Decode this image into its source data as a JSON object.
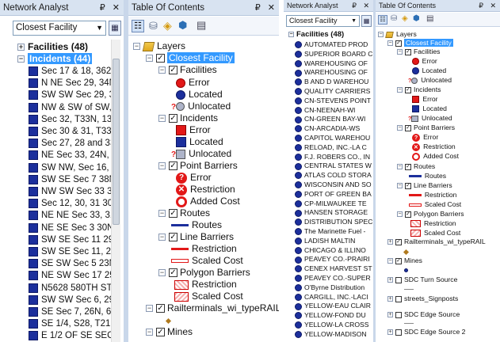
{
  "left_image": {
    "network_analyst": {
      "title": "Network Analyst",
      "title_buttons": "₽ ✕",
      "combo_value": "Closest Facility",
      "facilities_label": "Facilities (48)",
      "incidents_label": "Incidents (44)",
      "incidents": [
        "Sec 17 & 18, 362 25",
        "N NE Sec 29, 34N, 1(",
        "SW SW Sec 29, 34N,",
        "NW & SW of SW, Se",
        "Sec 32, T33N, 13W, 7",
        "Sec 30 & 31, T33N, 1",
        "Sec 27, 28 and 33, T",
        "NE Sec 33, 24N, 11W",
        "SW NW, Sec 16, 19N",
        "SW SE Sec 7 38N 19\\",
        "NW SW Sec 33 31N 1",
        "Sec 12, 30, 31 30N 1(",
        "NE NE Sec 33, 31N, 1",
        "NE SE Sec 3 30N 10W",
        "SW SE Sec 11 29N 1",
        "SW SE Sec 11, 25N, 1",
        "SE SW Sec 5 23N 2W",
        "NE SW Sec 17 25N 1",
        "N5628 580TH ST",
        "SW SW Sec 6, 29N, 1",
        "SE Sec 7, 26N, 6W, S",
        "SE 1/4, S28, T21N, R",
        "E 1/2 OF SE SEC 1"
      ]
    },
    "toc": {
      "title": "Table Of Contents",
      "title_buttons": "₽ ✕",
      "layers": "Layers",
      "closest_facility": "Closest Facility",
      "facilities": "Facilities",
      "error": "Error",
      "located": "Located",
      "unlocated": "Unlocated",
      "incidents": "Incidents",
      "point_barriers": "Point Barriers",
      "pb_error": "Error",
      "pb_restriction": "Restriction",
      "pb_added_cost": "Added Cost",
      "routes": "Routes",
      "routes_item": "Routes",
      "line_barriers": "Line Barriers",
      "lb_restriction": "Restriction",
      "lb_scaled_cost": "Scaled Cost",
      "polygon_barriers": "Polygon Barriers",
      "pg_restriction": "Restriction",
      "pg_scaled_cost": "Scaled Cost",
      "railterminals": "Railterminals_wi_typeRAIL",
      "mines": "Mines"
    }
  },
  "right_image": {
    "network_analyst": {
      "title": "Network Analyst",
      "title_buttons": "₽ ✕",
      "combo_value": "Closest Facility",
      "facilities_label": "Facilities (48)",
      "facilities": [
        "AUTOMATED PROD",
        "SUPERIOR BOARD C",
        "WAREHOUSING OF",
        "WAREHOUSING OF",
        "B AND D WAREHOU",
        "QUALITY CARRIERS",
        "CN-STEVENS POINT",
        "CN-NEENAH-WI",
        "CN-GREEN BAY-WI",
        "CN-ARCADIA-WS",
        "CAPITOL WAREHOU",
        "RELOAD, INC.-LA C",
        "F.J. ROBERS CO., IN",
        "CENTRAL STATES W",
        "ATLAS COLD STORA",
        "WISCONSIN AND SO",
        "PORT OF GREEN BA",
        "CP-MILWAUKEE TE",
        "HANSEN STORAGE",
        "DISTRIBUTION SPEC",
        "The Marinette Fuel -",
        "LADISH MALTIN",
        "CHICAGO & ILLINO",
        "PEAVEY CO.-PRAIRI",
        "CENEX HARVEST ST",
        "PEAVEY CO.-SUPER",
        "O'Byrne Distribution",
        "CARGILL, INC.-LACI",
        "YELLOW-EAU CLAIR",
        "YELLOW-FOND DU",
        "YELLOW-LA CROSS",
        "YELLOW-MADISON"
      ]
    },
    "toc": {
      "title": "Table Of Contents",
      "title_buttons": "₽ ✕",
      "layers": "Layers",
      "closest_facility": "Closest Facility",
      "facilities": "Facilities",
      "error": "Error",
      "located": "Located",
      "unlocated": "Unlocated",
      "incidents": "Incidents",
      "inc_error": "Error",
      "inc_located": "Located",
      "inc_unlocated": "Unlocated",
      "point_barriers": "Point Barriers",
      "pb_error": "Error",
      "pb_restriction": "Restriction",
      "pb_added_cost": "Added Cost",
      "routes": "Routes",
      "routes_item": "Routes",
      "line_barriers": "Line Barriers",
      "lb_restriction": "Restriction",
      "lb_scaled_cost": "Scaled Cost",
      "polygon_barriers": "Polygon Barriers",
      "pg_restriction": "Restriction",
      "pg_scaled_cost": "Scaled Cost",
      "railterminals": "Railterminals_wi_typeRAIL",
      "mines": "Mines",
      "sdc_turn": "SDC Turn Source",
      "streets_signposts": "streets_Signposts",
      "sdc_edge": "SDC Edge Source",
      "sdc_edge2": "SDC Edge Source 2"
    }
  },
  "colors": {
    "selection": "#3399ff",
    "title_bar": "#d8e3f1",
    "feature_blue": "#1c2f9c",
    "error_red": "#e21818"
  }
}
